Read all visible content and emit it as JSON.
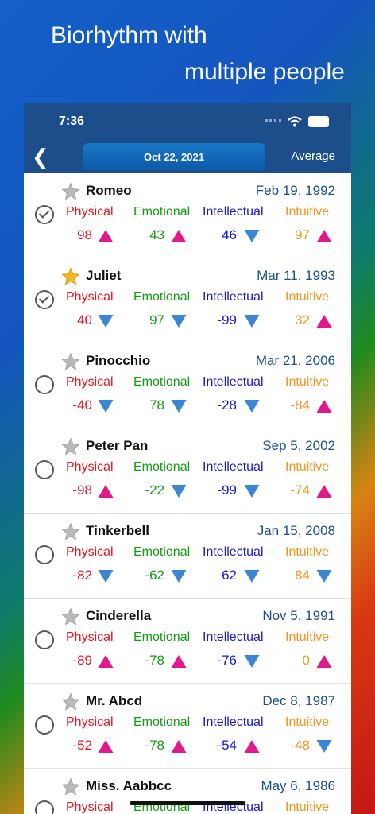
{
  "headline": {
    "line1": "Biorhythm with",
    "line2": "multiple people"
  },
  "status": {
    "time": "7:36"
  },
  "nav": {
    "date": "Oct 22, 2021",
    "average_label": "Average"
  },
  "labels": {
    "physical": "Physical",
    "emotional": "Emotional",
    "intellectual": "Intellectual",
    "intuitive": "Intuitive"
  },
  "colors": {
    "pink": "#e0198c",
    "blue": "#3a86d4",
    "nav": "#1d4e8c"
  },
  "people": [
    {
      "name": "Romeo",
      "dob": "Feb 19, 1992",
      "checked": true,
      "favorite": false,
      "values": [
        {
          "v": "98",
          "dir": "up"
        },
        {
          "v": "43",
          "dir": "up"
        },
        {
          "v": "46",
          "dir": "down"
        },
        {
          "v": "97",
          "dir": "up"
        }
      ]
    },
    {
      "name": "Juliet",
      "dob": "Mar 11, 1993",
      "checked": true,
      "favorite": true,
      "values": [
        {
          "v": "40",
          "dir": "down"
        },
        {
          "v": "97",
          "dir": "down"
        },
        {
          "v": "-99",
          "dir": "down"
        },
        {
          "v": "32",
          "dir": "up"
        }
      ]
    },
    {
      "name": "Pinocchio",
      "dob": "Mar 21, 2006",
      "checked": false,
      "favorite": false,
      "values": [
        {
          "v": "-40",
          "dir": "down"
        },
        {
          "v": "78",
          "dir": "down"
        },
        {
          "v": "-28",
          "dir": "down"
        },
        {
          "v": "-84",
          "dir": "up"
        }
      ]
    },
    {
      "name": "Peter Pan",
      "dob": "Sep 5, 2002",
      "checked": false,
      "favorite": false,
      "values": [
        {
          "v": "-98",
          "dir": "up"
        },
        {
          "v": "-22",
          "dir": "down"
        },
        {
          "v": "-99",
          "dir": "down"
        },
        {
          "v": "-74",
          "dir": "up"
        }
      ]
    },
    {
      "name": "Tinkerbell",
      "dob": "Jan 15, 2008",
      "checked": false,
      "favorite": false,
      "values": [
        {
          "v": "-82",
          "dir": "down"
        },
        {
          "v": "-62",
          "dir": "down"
        },
        {
          "v": "62",
          "dir": "down"
        },
        {
          "v": "84",
          "dir": "down"
        }
      ]
    },
    {
      "name": "Cinderella",
      "dob": "Nov 5, 1991",
      "checked": false,
      "favorite": false,
      "values": [
        {
          "v": "-89",
          "dir": "up"
        },
        {
          "v": "-78",
          "dir": "up"
        },
        {
          "v": "-76",
          "dir": "down"
        },
        {
          "v": "0",
          "dir": "up"
        }
      ]
    },
    {
      "name": "Mr. Abcd",
      "dob": "Dec 8, 1987",
      "checked": false,
      "favorite": false,
      "values": [
        {
          "v": "-52",
          "dir": "up"
        },
        {
          "v": "-78",
          "dir": "up"
        },
        {
          "v": "-54",
          "dir": "up"
        },
        {
          "v": "-48",
          "dir": "down"
        }
      ]
    },
    {
      "name": "Miss. Aabbcc",
      "dob": "May 6, 1986",
      "checked": false,
      "favorite": false,
      "values": []
    }
  ]
}
